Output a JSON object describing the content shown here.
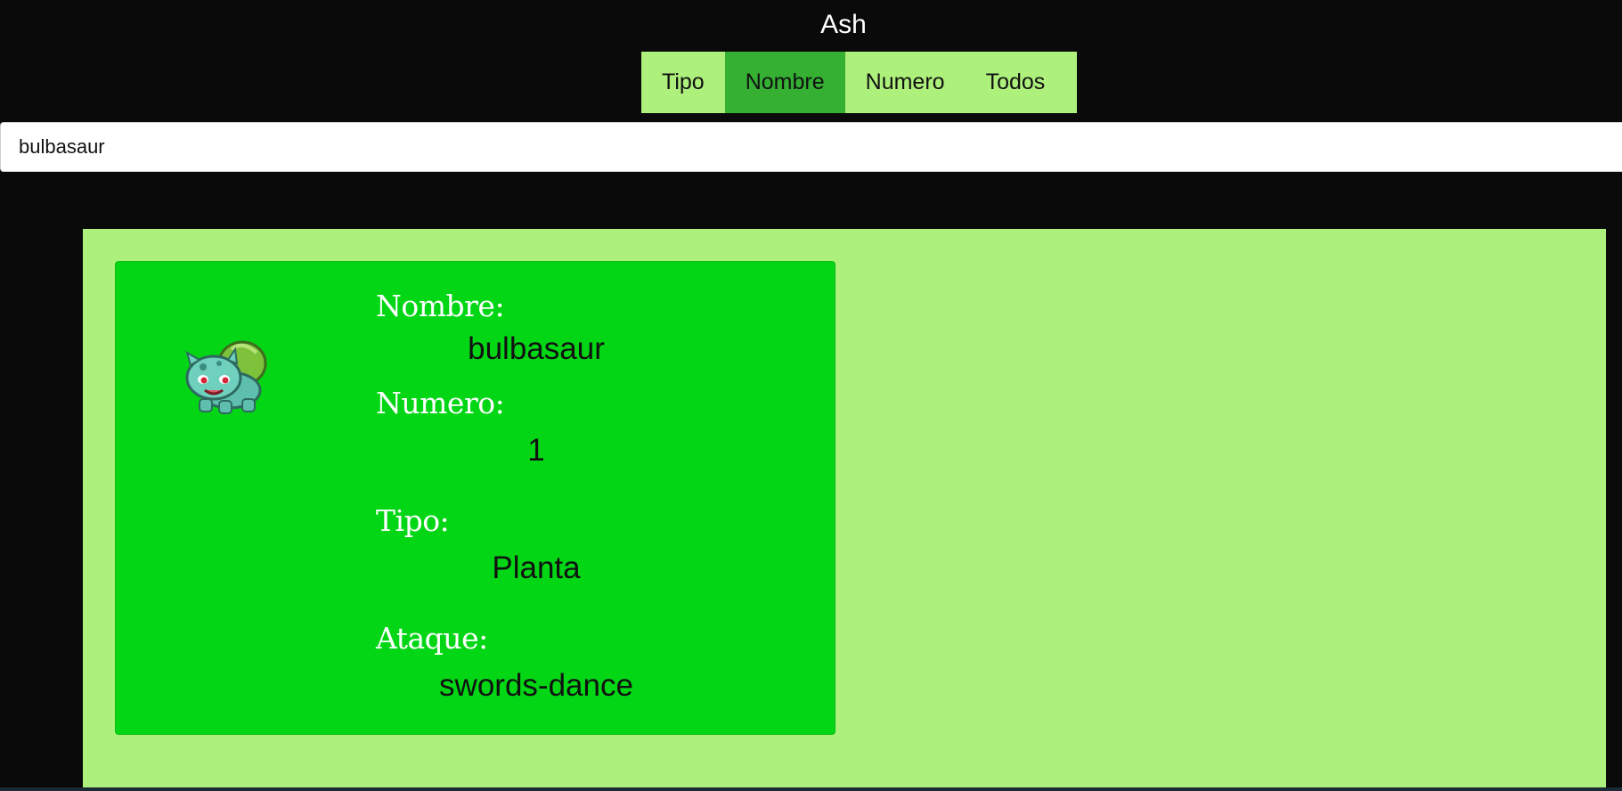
{
  "header": {
    "title": "Ash"
  },
  "tabs": [
    {
      "label": "Tipo",
      "active": false
    },
    {
      "label": "Nombre",
      "active": true
    },
    {
      "label": "Numero",
      "active": false
    },
    {
      "label": "Todos",
      "active": false
    }
  ],
  "search": {
    "value": "bulbasaur"
  },
  "card": {
    "sprite_icon": "bulbasaur-sprite-icon",
    "fields": [
      {
        "label": "Nombre:",
        "value": "bulbasaur"
      },
      {
        "label": "Numero:",
        "value": "1"
      },
      {
        "label": "Tipo:",
        "value": "Planta"
      },
      {
        "label": "Ataque:",
        "value": "swords-dance"
      }
    ]
  },
  "colors": {
    "page_background": "#0a0a0b",
    "tab_background": "#aef07c",
    "tab_active": "#35b033",
    "results_background": "#aef07c",
    "card_background": "#03d615"
  }
}
